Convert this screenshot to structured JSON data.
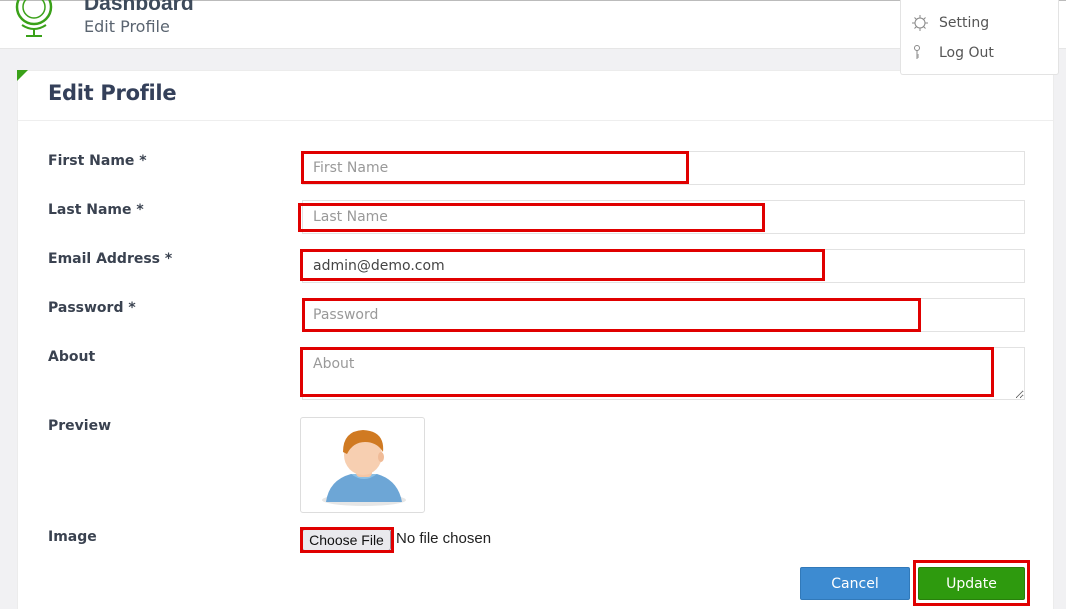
{
  "header": {
    "app_title": "Dashboard",
    "page_subtitle": "Edit Profile"
  },
  "user_menu": {
    "items": [
      {
        "label": "Setting",
        "icon": "gear-icon"
      },
      {
        "label": "Log Out",
        "icon": "key-icon"
      }
    ]
  },
  "form": {
    "title": "Edit Profile",
    "first_name": {
      "label": "First Name *",
      "placeholder": "First Name",
      "value": ""
    },
    "last_name": {
      "label": "Last Name *",
      "placeholder": "Last Name",
      "value": ""
    },
    "email": {
      "label": "Email Address *",
      "placeholder": "",
      "value": "admin@demo.com"
    },
    "password": {
      "label": "Password *",
      "placeholder": "Password",
      "value": ""
    },
    "about": {
      "label": "About",
      "placeholder": "About",
      "value": ""
    },
    "preview": {
      "label": "Preview",
      "image": "default-user-avatar"
    },
    "image": {
      "label": "Image",
      "button_label": "Choose File",
      "status": "No file chosen"
    },
    "cancel_label": "Cancel",
    "update_label": "Update"
  },
  "colors": {
    "accent_green": "#2e9a0e",
    "cancel_blue": "#3d8bd1",
    "highlight_red": "#e00000"
  }
}
